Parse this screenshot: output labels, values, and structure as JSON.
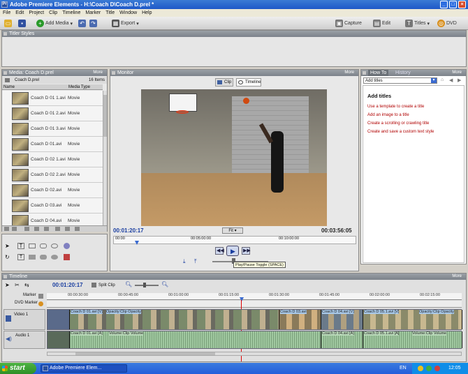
{
  "window": {
    "title": "Adobe Premiere Elements - H:\\Coach D\\Coach D.prel *",
    "min": "_",
    "max": "□",
    "close": "×"
  },
  "menu": [
    "File",
    "Edit",
    "Project",
    "Clip",
    "Timeline",
    "Marker",
    "Title",
    "Window",
    "Help"
  ],
  "toolbar": {
    "add_media": "Add Media",
    "export": "Export",
    "capture": "Capture",
    "edit": "Edit",
    "titles": "Titles",
    "dvd": "DVD"
  },
  "titler_styles": {
    "title": "Titler Styles"
  },
  "media": {
    "title": "Media: Coach D.prel",
    "more": "More",
    "project": "Coach D.prel",
    "item_count": "16 Items",
    "col_name": "Name",
    "col_type": "Media Type",
    "items": [
      {
        "name": "Coach D 01 1.avi",
        "type": "Movie"
      },
      {
        "name": "Coach D 01 2.avi",
        "type": "Movie"
      },
      {
        "name": "Coach D 01 3.avi",
        "type": "Movie"
      },
      {
        "name": "Coach D 01.avi",
        "type": "Movie"
      },
      {
        "name": "Coach D 02 1.avi",
        "type": "Movie"
      },
      {
        "name": "Coach D 02 2.avi",
        "type": "Movie"
      },
      {
        "name": "Coach D 02.avi",
        "type": "Movie"
      },
      {
        "name": "Coach D 03.avi",
        "type": "Movie"
      },
      {
        "name": "Coach D 04.avi",
        "type": "Movie"
      }
    ]
  },
  "monitor": {
    "title": "Monitor",
    "more": "More",
    "tab_clip": "Clip",
    "tab_timeline": "Timeline",
    "current_time": "00:01:20:17",
    "duration": "00:03:56:05",
    "fit": "Fit",
    "ruler_ticks": [
      "00:00",
      "00:05:00:00",
      "00:10:00:00"
    ],
    "tooltip": "Play/Pause Toggle (SPACE)"
  },
  "howto": {
    "tab_howto": "How To",
    "tab_history": "History",
    "more": "More",
    "dropdown": "Add titles",
    "heading": "Add titles",
    "links": [
      "Use a template to create a title",
      "Add an image to a title",
      "Create a scrolling or crawling title",
      "Create and save a custom text style"
    ]
  },
  "timeline": {
    "title": "Timeline",
    "more": "More",
    "current_time": "00:01:20:17",
    "split_clip": "Split Clip",
    "marker": "Marker",
    "dvd_marker": "DVD Marker",
    "ticks": [
      "00:00:30:00",
      "00:00:45:00",
      "00:01:00:00",
      "00:01:15:00",
      "00:01:30:00",
      "00:01:45:00",
      "00:02:00:00",
      "00:02:15:00"
    ],
    "video_track": "Video 1",
    "audio_track": "Audio 1",
    "video_labels": [
      "Coach D 01.avi [V]",
      "Opacity:Clip Opacity",
      "Coach D 03.avi",
      "Coach D 04.avi [V]",
      "Coach D 05.1.avi [V]",
      "Opacity:Clip Opacity"
    ],
    "audio_labels": [
      "Coach D 01.avi [A]",
      "Volume:Clip Volume",
      "Coach D 04.avi [A]",
      "Coach D 05.1.avi [A]",
      "Volume:Clip Volume"
    ]
  },
  "taskbar": {
    "start": "start",
    "item": "Adobe Premiere Elem...",
    "lang": "EN",
    "clock": "12:05"
  }
}
